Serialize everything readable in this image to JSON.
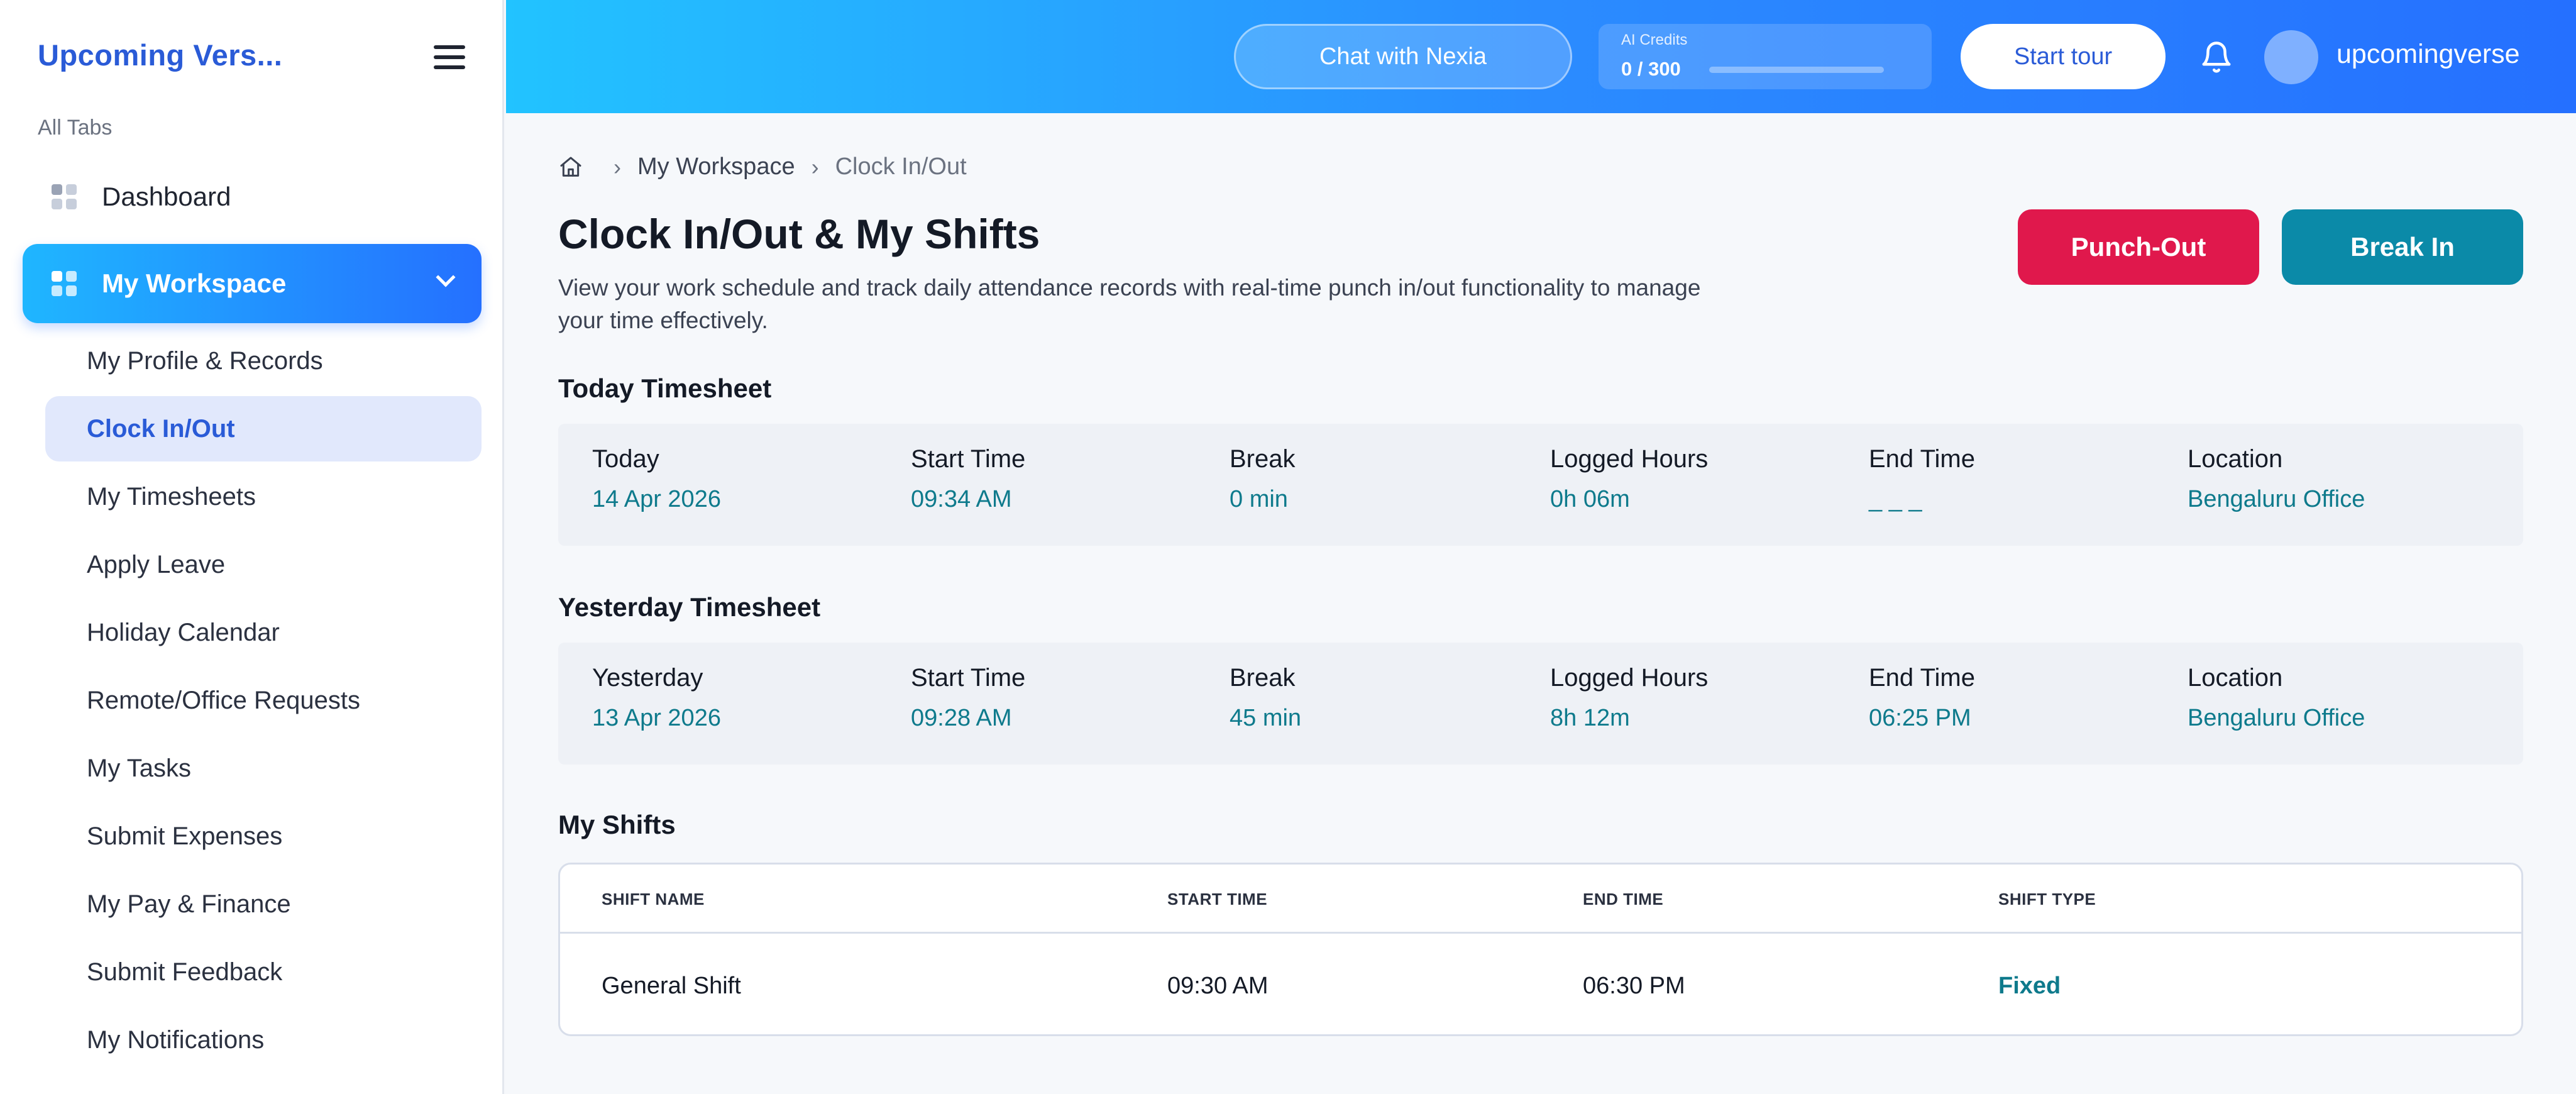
{
  "sidebar": {
    "brand": "Upcoming Vers...",
    "section_label": "All Tabs",
    "dashboard_label": "Dashboard",
    "workspace_label": "My Workspace",
    "items": [
      {
        "label": "My Profile & Records"
      },
      {
        "label": "Clock In/Out"
      },
      {
        "label": "My Timesheets"
      },
      {
        "label": "Apply Leave"
      },
      {
        "label": "Holiday Calendar"
      },
      {
        "label": "Remote/Office Requests"
      },
      {
        "label": "My Tasks"
      },
      {
        "label": "Submit Expenses"
      },
      {
        "label": "My Pay & Finance"
      },
      {
        "label": "Submit Feedback"
      },
      {
        "label": "My Notifications"
      }
    ],
    "active_item": "Clock In/Out"
  },
  "topbar": {
    "chat_label": "Chat with Nexia",
    "credits_label": "AI Credits",
    "credits_value": "0 / 300",
    "credits_used_fraction": 0,
    "tour_label": "Start tour",
    "username": "upcomingverse"
  },
  "breadcrumb": {
    "workspace": "My Workspace",
    "current": "Clock In/Out"
  },
  "page": {
    "title": "Clock In/Out & My Shifts",
    "description": "View your work schedule and track daily attendance records with real-time punch in/out functionality to manage your time effectively.",
    "punch_out_label": "Punch-Out",
    "break_in_label": "Break In"
  },
  "today": {
    "section_title": "Today Timesheet",
    "columns": [
      {
        "label": "Today",
        "value": "14 Apr 2026"
      },
      {
        "label": "Start Time",
        "value": "09:34 AM"
      },
      {
        "label": "Break",
        "value": "0 min"
      },
      {
        "label": "Logged Hours",
        "value": "0h 06m"
      },
      {
        "label": "End Time",
        "value": "_ _ _"
      },
      {
        "label": "Location",
        "value": "Bengaluru Office"
      }
    ]
  },
  "yesterday": {
    "section_title": "Yesterday Timesheet",
    "columns": [
      {
        "label": "Yesterday",
        "value": "13 Apr 2026"
      },
      {
        "label": "Start Time",
        "value": "09:28 AM"
      },
      {
        "label": "Break",
        "value": "45 min"
      },
      {
        "label": "Logged Hours",
        "value": "8h 12m"
      },
      {
        "label": "End Time",
        "value": "06:25 PM"
      },
      {
        "label": "Location",
        "value": "Bengaluru Office"
      }
    ]
  },
  "shifts": {
    "section_title": "My Shifts",
    "headers": [
      "SHIFT NAME",
      "START TIME",
      "END TIME",
      "SHIFT TYPE"
    ],
    "rows": [
      {
        "name": "General Shift",
        "start": "09:30 AM",
        "end": "06:30 PM",
        "type": "Fixed"
      }
    ]
  }
}
